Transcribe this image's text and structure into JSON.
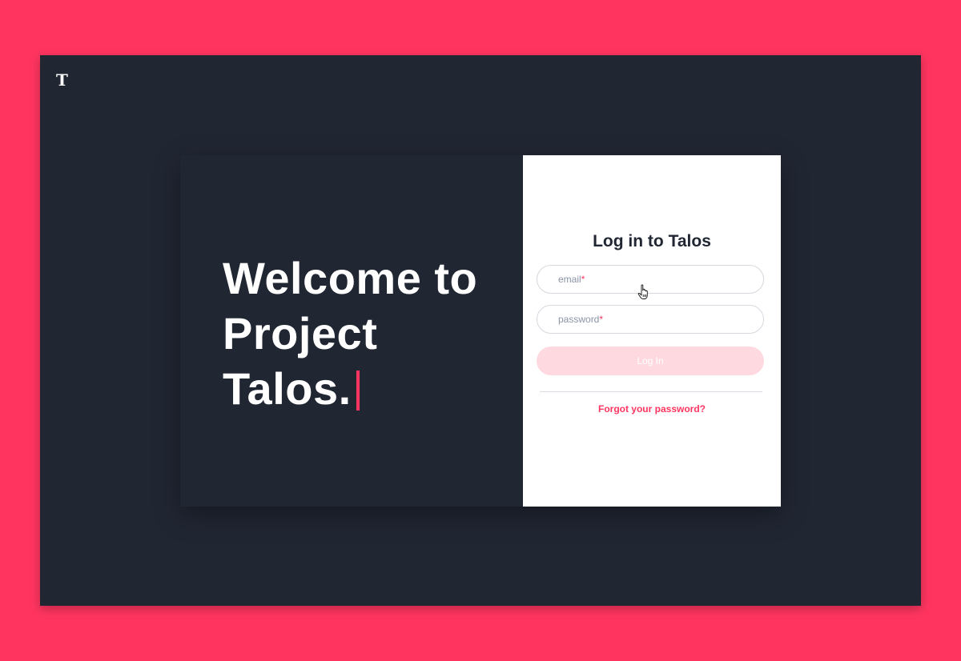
{
  "brand": {
    "logo_text": "T"
  },
  "hero": {
    "line1": "Welcome to",
    "line2": "Project",
    "line3": "Talos."
  },
  "login": {
    "title": "Log in to Talos",
    "email_label": "email",
    "password_label": "password",
    "required_mark": "*",
    "button_label": "Log In",
    "forgot_link": "Forgot your password?"
  },
  "colors": {
    "background": "#ff3560",
    "panel": "#212633",
    "accent": "#ff3560",
    "button_disabled": "#ffd9e0",
    "card_right": "#ffffff"
  },
  "icons": {
    "cursor": "hand-pointer-icon"
  }
}
